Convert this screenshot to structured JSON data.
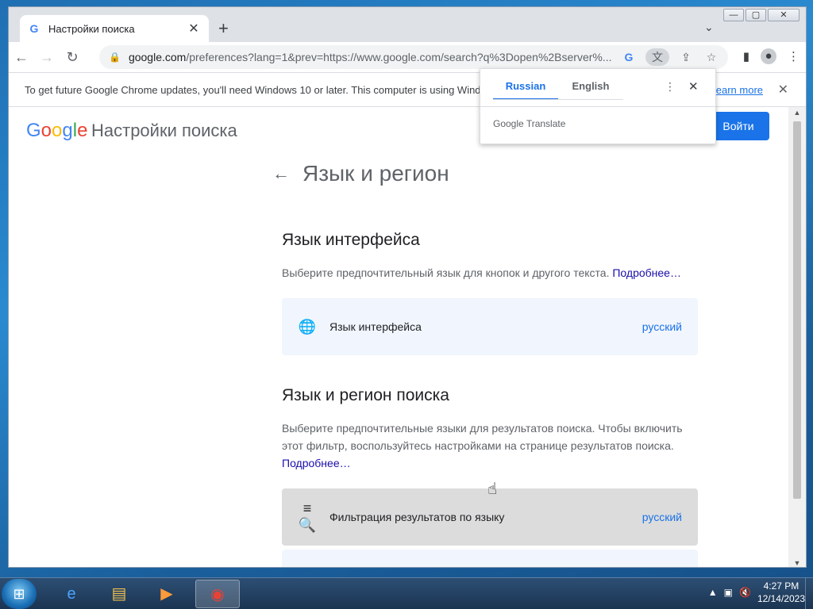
{
  "browser": {
    "tab_title": "Настройки поиска",
    "tab_favicon": "G",
    "new_tab": "+",
    "tab_search": "⌄",
    "window_controls": {
      "minimize": "—",
      "maximize": "▢",
      "close": "✕"
    },
    "url_host": "google.com",
    "url_rest": "/preferences?lang=1&prev=https://www.google.com/search?q%3Dopen%2Bserver%...",
    "nav": {
      "back": "←",
      "forward": "→",
      "reload": "↻"
    }
  },
  "infobar": {
    "message": "To get future Google Chrome updates, you'll need Windows 10 or later. This computer is using Wind",
    "learn_more": "earn more",
    "close": "✕"
  },
  "translate_bubble": {
    "tabs": [
      "Russian",
      "English"
    ],
    "active_tab": "Russian",
    "brand": "Google Translate",
    "more": "⋮",
    "close": "✕"
  },
  "page": {
    "logo": {
      "G": "G",
      "o1": "o",
      "o2": "o",
      "g": "g",
      "l": "l",
      "e": "e"
    },
    "title": "Настройки поиска",
    "signin": "Войти",
    "heading": "Язык и регион",
    "interface_section": {
      "title": "Язык интерфейса",
      "description": "Выберите предпочтительный язык для кнопок и другого текста.",
      "link": "Подробнее…",
      "card_label": "Язык интерфейса",
      "card_value": "русский"
    },
    "search_section": {
      "title": "Язык и регион поиска",
      "description": "Выберите предпочтительные языки для результатов поиска. Чтобы включить этот фильтр, воспользуйтесь настройками на странице результатов поиска.",
      "link": "Подробнее…",
      "card_label": "Фильтрация результатов по языку",
      "card_value": "русский"
    }
  },
  "taskbar": {
    "time": "4:27 PM",
    "date": "12/14/2023",
    "apps": [
      "ie-icon",
      "explorer-icon",
      "media-player-icon",
      "chrome-icon"
    ]
  }
}
